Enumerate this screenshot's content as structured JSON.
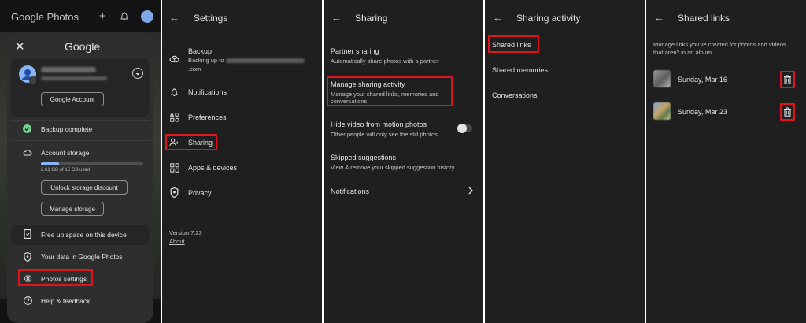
{
  "panel1": {
    "app_title": "Google Photos",
    "sheet_title": "Google",
    "google_account_btn": "Google Account",
    "backup_status": "Backup complete",
    "account_storage": "Account storage",
    "storage_usage": "2.61 GB of 15 GB used",
    "storage_used_fraction": 0.174,
    "unlock_btn": "Unlock storage discount",
    "manage_btn": "Manage storage",
    "free_up": "Free up space on this device",
    "your_data": "Your data in Google Photos",
    "photos_settings": "Photos settings",
    "help": "Help & feedback"
  },
  "panel2": {
    "title": "Settings",
    "backup_title": "Backup",
    "backup_sub_prefix": "Backing up to",
    "backup_sub_suffix": ".com",
    "notifications": "Notifications",
    "preferences": "Preferences",
    "sharing": "Sharing",
    "apps_devices": "Apps & devices",
    "privacy": "Privacy",
    "version": "Version 7.23",
    "about": "About"
  },
  "panel3": {
    "title": "Sharing",
    "partner_title": "Partner sharing",
    "partner_sub": "Automatically share photos with a partner",
    "manage_title": "Manage sharing activity",
    "manage_sub1": "Manage your shared links, memories and",
    "manage_sub2": "conversations",
    "hide_title": "Hide video from motion photos",
    "hide_sub": "Other people will only see the still photos",
    "skipped_title": "Skipped suggestions",
    "skipped_sub": "View & remove your skipped suggestion history",
    "notifications": "Notifications"
  },
  "panel4": {
    "title": "Sharing activity",
    "shared_links": "Shared links",
    "shared_memories": "Shared memories",
    "conversations": "Conversations"
  },
  "panel5": {
    "title": "Shared links",
    "desc1": "Manage links you've created for photos and videos",
    "desc2": "that aren't in an album",
    "link1_date": "Sunday, Mar 16",
    "link2_date": "Sunday, Mar 23"
  },
  "colors": {
    "highlight": "#e0141e",
    "accent": "#8ab4f8",
    "panel_bg": "#1f1f1f"
  }
}
